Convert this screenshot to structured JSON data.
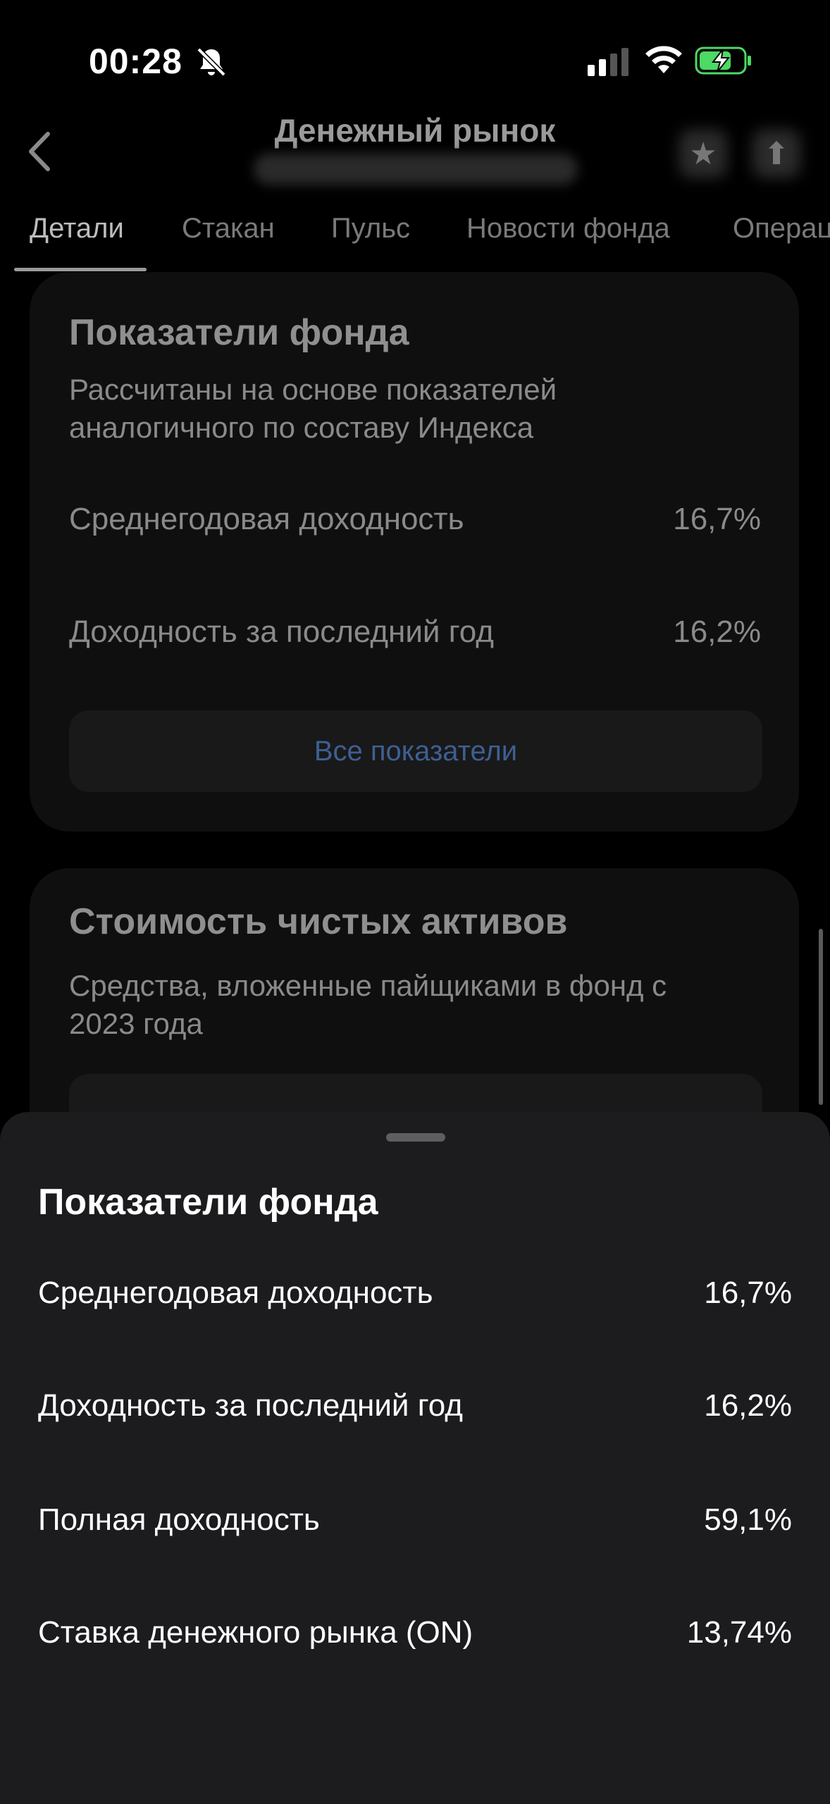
{
  "status_bar": {
    "time": "00:28"
  },
  "header": {
    "title": "Денежный рынок"
  },
  "tabs": [
    {
      "label": "Детали",
      "active": true
    },
    {
      "label": "Стакан",
      "active": false
    },
    {
      "label": "Пульс",
      "active": false
    },
    {
      "label": "Новости фонда",
      "active": false
    },
    {
      "label": "Операц",
      "active": false
    }
  ],
  "fund_card": {
    "title": "Показатели фонда",
    "description": "Рассчитаны на основе показателей аналогичного по составу Индекса",
    "metrics": [
      {
        "label": "Среднегодовая доходность",
        "value": "16,7%"
      },
      {
        "label": "Доходность за последний год",
        "value": "16,2%"
      }
    ],
    "all_button": "Все показатели"
  },
  "nav_card": {
    "title": "Стоимость чистых активов",
    "description": "Средства, вложенные пайщиками в фонд с 2023 года"
  },
  "sheet": {
    "title": "Показатели фонда",
    "rows": [
      {
        "label": "Среднегодовая доходность",
        "value": "16,7%"
      },
      {
        "label": "Доходность за последний год",
        "value": "16,2%"
      },
      {
        "label": "Полная доходность",
        "value": "59,1%"
      },
      {
        "label": "Ставка денежного рынка (ON)",
        "value": "13,74%"
      }
    ]
  },
  "colors": {
    "accent_link": "#3d5f94",
    "battery_charging": "#4cd964",
    "sheet_bg": "#1c1c1e"
  }
}
